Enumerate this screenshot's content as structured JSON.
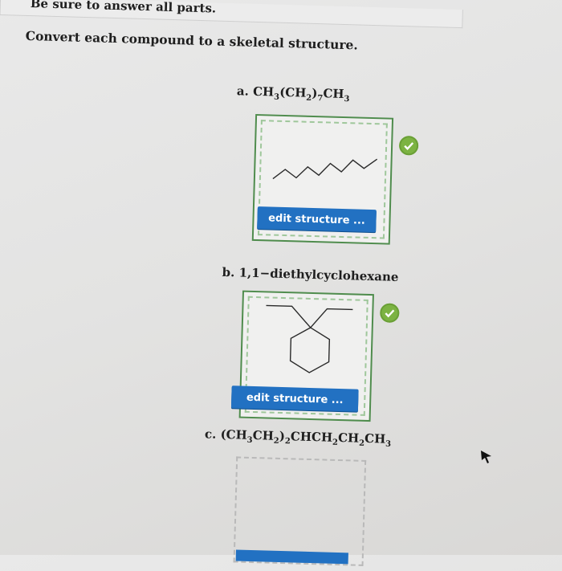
{
  "header": {
    "instruction": "Be sure to answer all parts."
  },
  "question": {
    "prompt": "Convert each compound to a skeletal structure."
  },
  "parts": [
    {
      "letter": "a.",
      "formula_html": "CH<sub>3</sub>(CH<sub>2</sub>)<sub>7</sub>CH<sub>3</sub>",
      "button": "edit structure ...",
      "status": "correct"
    },
    {
      "letter": "b.",
      "name": "1,1−diethylcyclohexane",
      "button": "edit structure ...",
      "status": "correct"
    },
    {
      "letter": "c.",
      "formula_html": "(CH<sub>3</sub>CH<sub>2</sub>)<sub>2</sub>CHCH<sub>2</sub>CH<sub>2</sub>CH<sub>3</sub>",
      "status": "unanswered"
    }
  ],
  "colors": {
    "correct": "#7cb342",
    "button": "#2271c2",
    "box_border": "#4f8c4d"
  },
  "icons": [
    "check-icon",
    "cursor-arrow-icon"
  ]
}
